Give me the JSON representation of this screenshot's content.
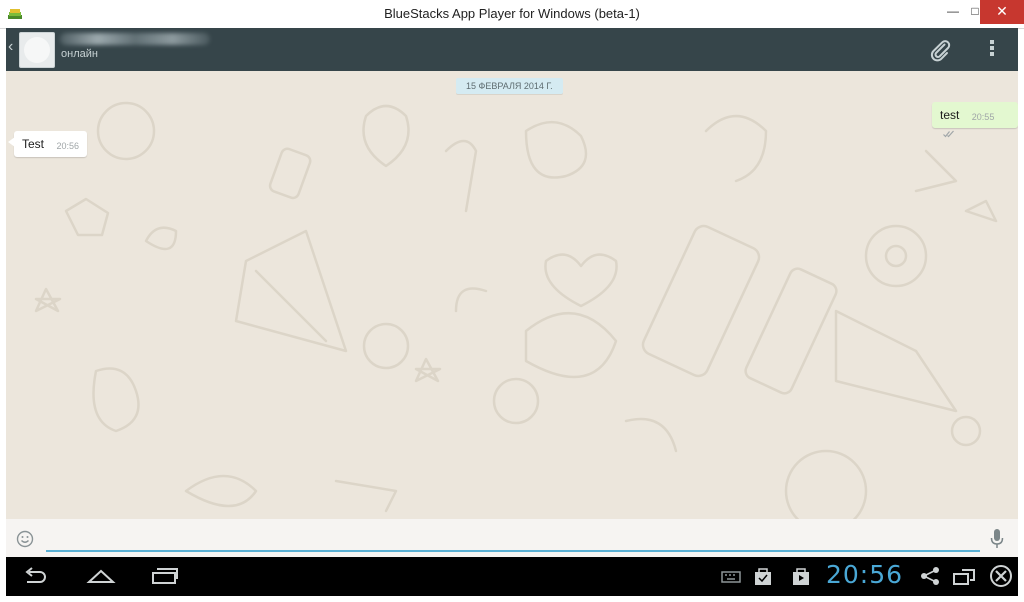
{
  "window": {
    "title": "BlueStacks App Player for Windows (beta-1)",
    "minimize_icon": "minimize-icon",
    "maximize_icon": "maximize-icon",
    "close_icon": "close-icon",
    "minimize_label": "—",
    "maximize_label": "□",
    "close_label": "✕"
  },
  "chat_header": {
    "back_label": "‹",
    "status": "онлайн"
  },
  "chat": {
    "date_chip": "15 ФЕВРАЛЯ 2014 Г.",
    "messages": [
      {
        "direction": "out",
        "text": "test",
        "time": "20:55",
        "status_icon": "double-check-icon"
      },
      {
        "direction": "in",
        "text": "Test",
        "time": "20:56"
      }
    ]
  },
  "input": {
    "value": "",
    "placeholder": ""
  },
  "navbar": {
    "clock": "20:56"
  },
  "colors": {
    "actionbar": "#36454a",
    "chat_bg": "#ece6dc",
    "outgoing_bubble": "#e3f8d0",
    "date_chip": "#d5ebf2",
    "accent_blue": "#4aa8d6",
    "close_red": "#c7372f"
  }
}
